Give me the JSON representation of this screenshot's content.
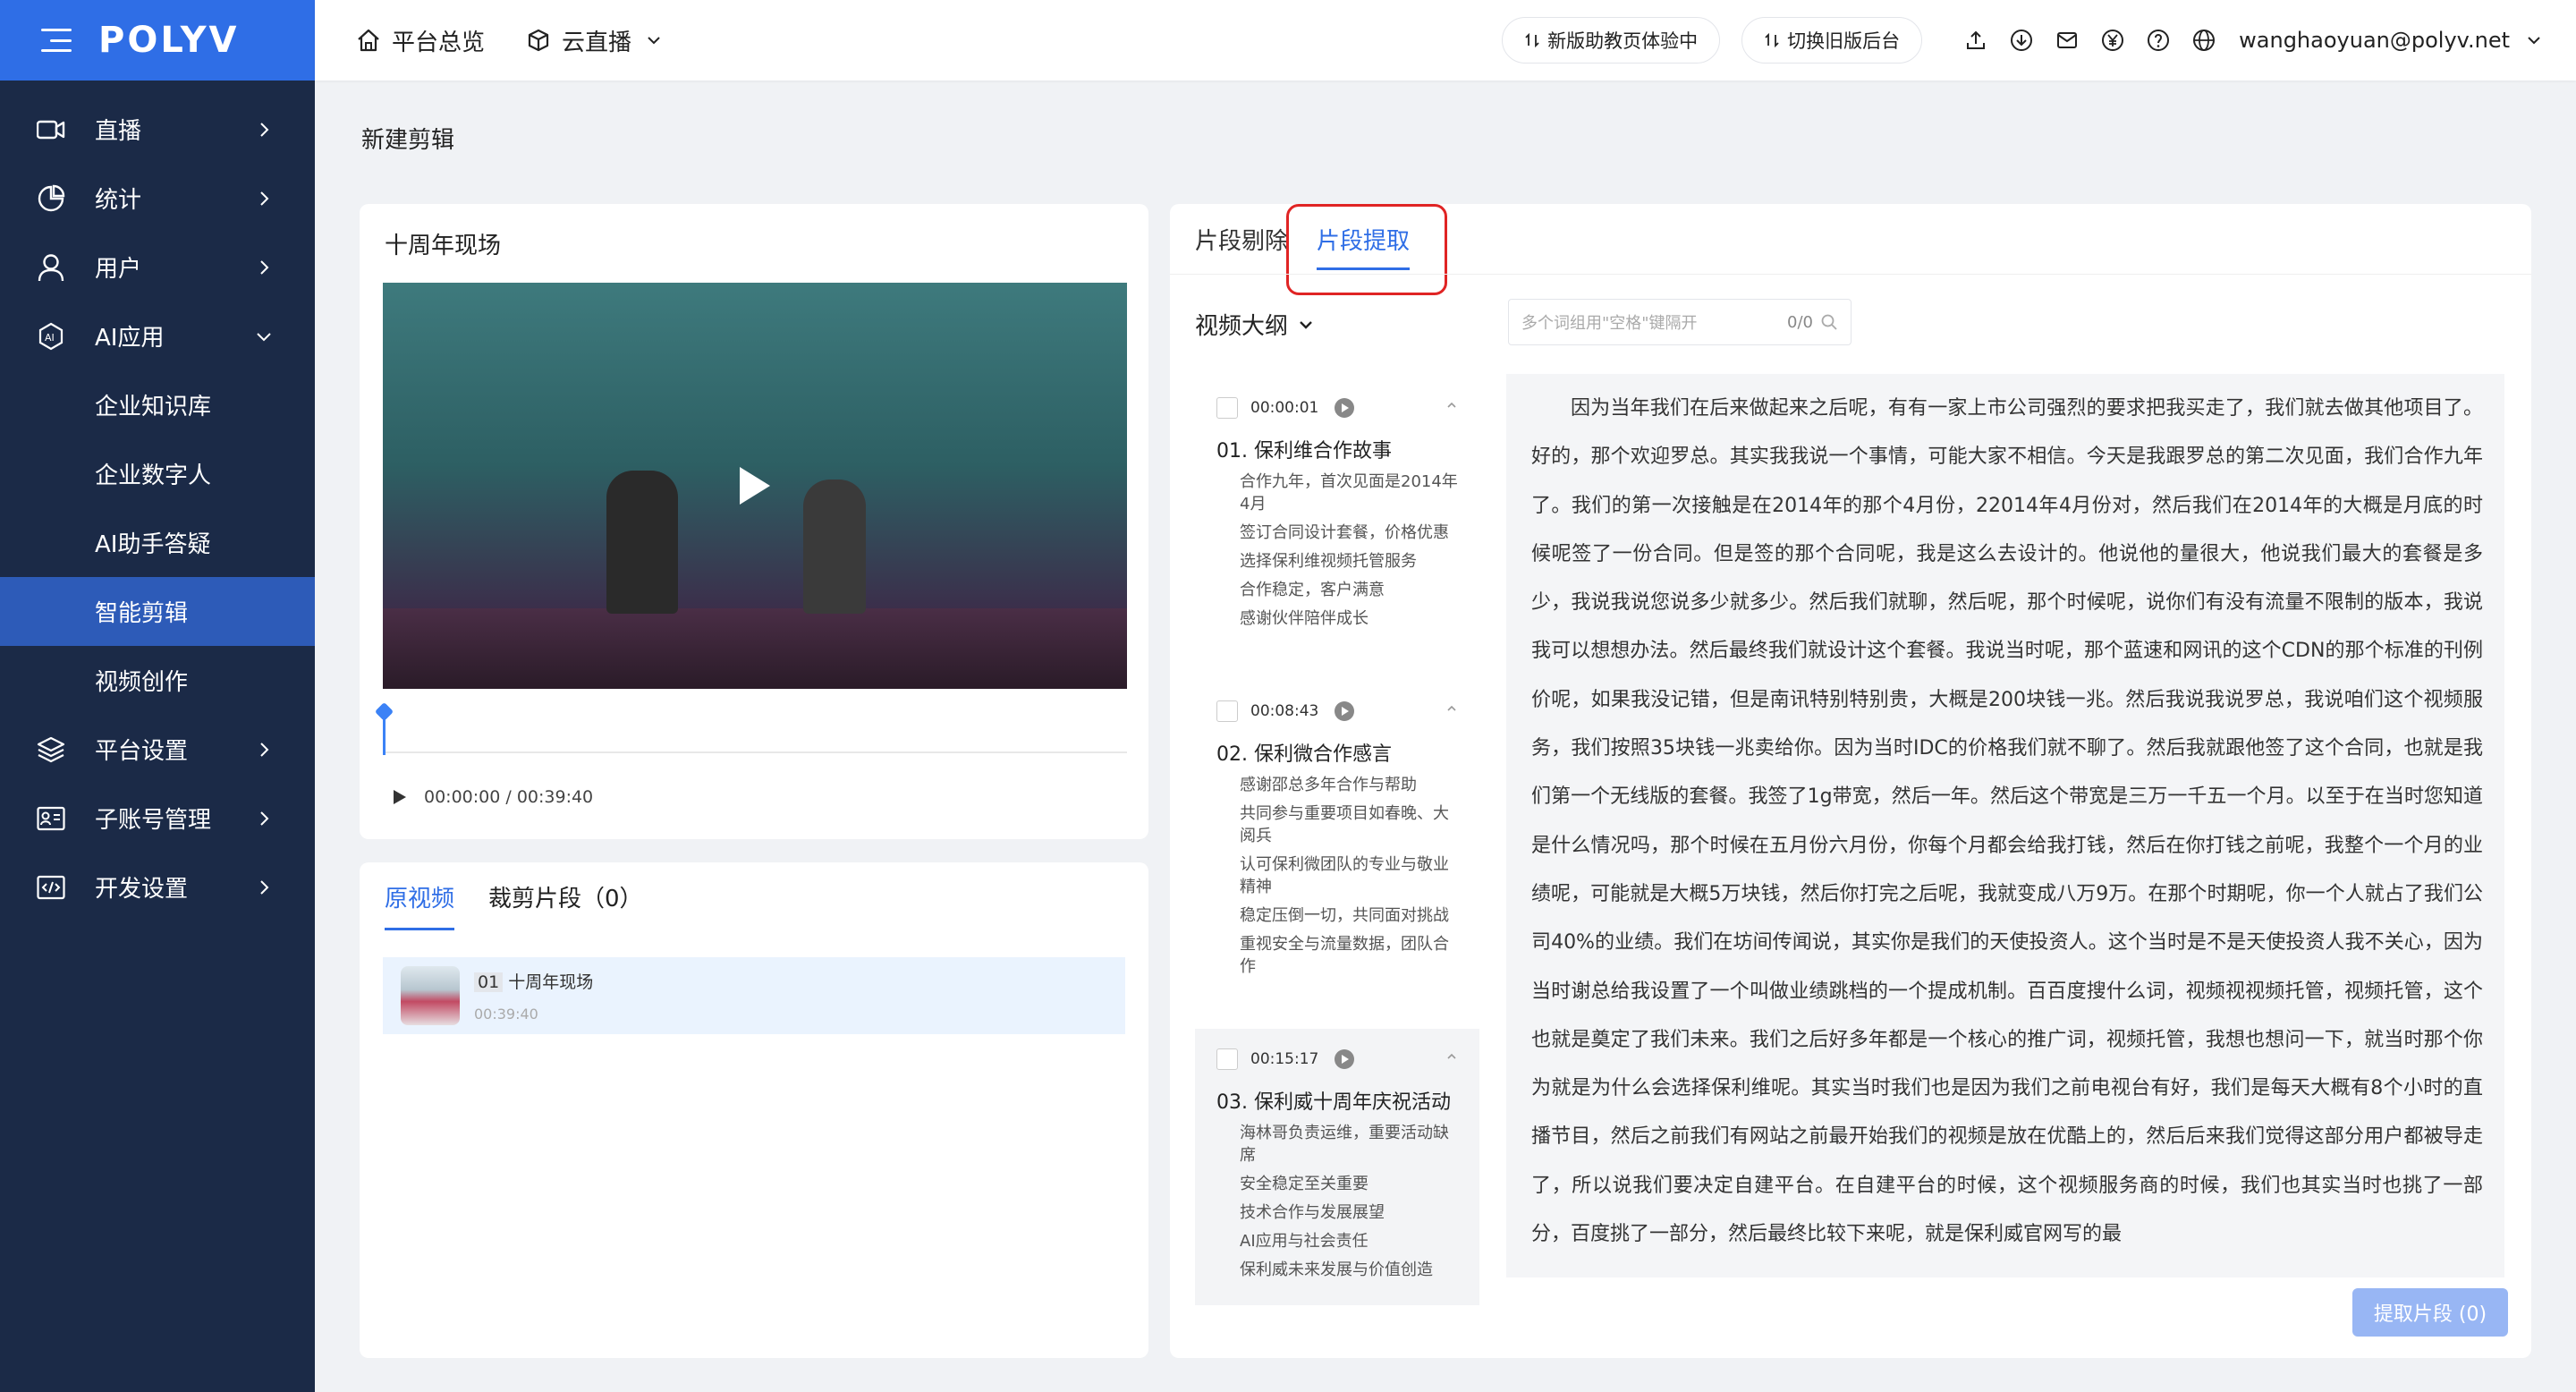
{
  "app": {
    "logo": "POLYV"
  },
  "sidebar": {
    "items": [
      {
        "label": "直播",
        "icon": "video-icon"
      },
      {
        "label": "统计",
        "icon": "chart-icon"
      },
      {
        "label": "用户",
        "icon": "user-icon"
      },
      {
        "label": "AI应用",
        "icon": "ai-icon"
      }
    ],
    "ai_sub": [
      {
        "label": "企业知识库"
      },
      {
        "label": "企业数字人"
      },
      {
        "label": "AI助手答疑"
      },
      {
        "label": "智能剪辑"
      },
      {
        "label": "视频创作"
      }
    ],
    "bottom_items": [
      {
        "label": "平台设置",
        "icon": "layers-icon"
      },
      {
        "label": "子账号管理",
        "icon": "id-card-icon"
      },
      {
        "label": "开发设置",
        "icon": "code-icon"
      }
    ]
  },
  "topbar": {
    "overview": "平台总览",
    "live": "云直播",
    "new_assistant": "新版助教页体验中",
    "switch_old": "切换旧版后台",
    "email": "wanghaoyuan@polyv.net"
  },
  "page": {
    "title": "新建剪辑"
  },
  "video": {
    "title": "十周年现场",
    "time": "00:00:00 / 00:39:40"
  },
  "clips": {
    "tab_original": "原视频",
    "tab_cut": "裁剪片段（0）",
    "item": {
      "index": "01",
      "name": "十周年现场",
      "duration": "00:39:40"
    }
  },
  "right": {
    "tab_delete": "片段剔除",
    "tab_extract": "片段提取",
    "outline_label": "视频大纲",
    "search_placeholder": "多个词组用\"空格\"键隔开",
    "search_count": "0/0",
    "extract_button": "提取片段 (0)"
  },
  "chapters": [
    {
      "time": "00:00:01",
      "title": "01. 保利维合作故事",
      "points": [
        "合作九年，首次见面是2014年4月",
        "签订合同设计套餐，价格优惠",
        "选择保利维视频托管服务",
        "合作稳定，客户满意",
        "感谢伙伴陪伴成长"
      ]
    },
    {
      "time": "00:08:43",
      "title": "02. 保利微合作感言",
      "points": [
        "感谢邵总多年合作与帮助",
        "共同参与重要项目如春晚、大阅兵",
        "认可保利微团队的专业与敬业精神",
        "稳定压倒一切，共同面对挑战",
        "重视安全与流量数据，团队合作"
      ]
    },
    {
      "time": "00:15:17",
      "title": "03. 保利威十周年庆祝活动",
      "points": [
        "海林哥负责运维，重要活动缺席",
        "安全稳定至关重要",
        "技术合作与发展展望",
        "AI应用与社会责任",
        "保利威未来发展与价值创造"
      ]
    }
  ],
  "transcript": "因为当年我们在后来做起来之后呢，有有一家上市公司强烈的要求把我买走了，我们就去做其他项目了。好的，那个欢迎罗总。其实我我说一个事情，可能大家不相信。今天是我跟罗总的第二次见面，我们合作九年了。我们的第一次接触是在2014年的那个4月份，22014年4月份对，然后我们在2014年的大概是月底的时候呢签了一份合同。但是签的那个合同呢，我是这么去设计的。他说他的量很大，他说我们最大的套餐是多少，我说我说您说多少就多少。然后我们就聊，然后呢，那个时候呢，说你们有没有流量不限制的版本，我说我可以想想办法。然后最终我们就设计这个套餐。我说当时呢，那个蓝速和网讯的这个CDN的那个标准的刊例价呢，如果我没记错，但是南讯特别特别贵，大概是200块钱一兆。然后我说我说罗总，我说咱们这个视频服务，我们按照35块钱一兆卖给你。因为当时IDC的价格我们就不聊了。然后我就跟他签了这个合同，也就是我们第一个无线版的套餐。我签了1g带宽，然后一年。然后这个带宽是三万一千五一个月。以至于在当时您知道是什么情况吗，那个时候在五月份六月份，你每个月都会给我打钱，然后在你打钱之前呢，我整个一个月的业绩呢，可能就是大概5万块钱，然后你打完之后呢，我就变成八万9万。在那个时期呢，你一个人就占了我们公司40%的业绩。我们在坊间传闻说，其实你是我们的天使投资人。这个当时是不是天使投资人我不关心，因为当时谢总给我设置了一个叫做业绩跳档的一个提成机制。百百度搜什么词，视频视视频托管，视频托管，这个也就是奠定了我们未来。我们之后好多年都是一个核心的推广词，视频托管，我想也想问一下，就当时那个你为就是为什么会选择保利维呢。其实当时我们也是因为我们之前电视台有好，我们是每天大概有8个小时的直播节目，然后之前我们有网站之前最开始我们的视频是放在优酷上的，然后后来我们觉得这部分用户都被导走了，所以说我们要决定自建平台。在自建平台的时候，这个视频服务商的时候，我们也其实当时也挑了一部分，百度挑了一部分，然后最终比较下来呢，就是保利威官网写的最"
}
